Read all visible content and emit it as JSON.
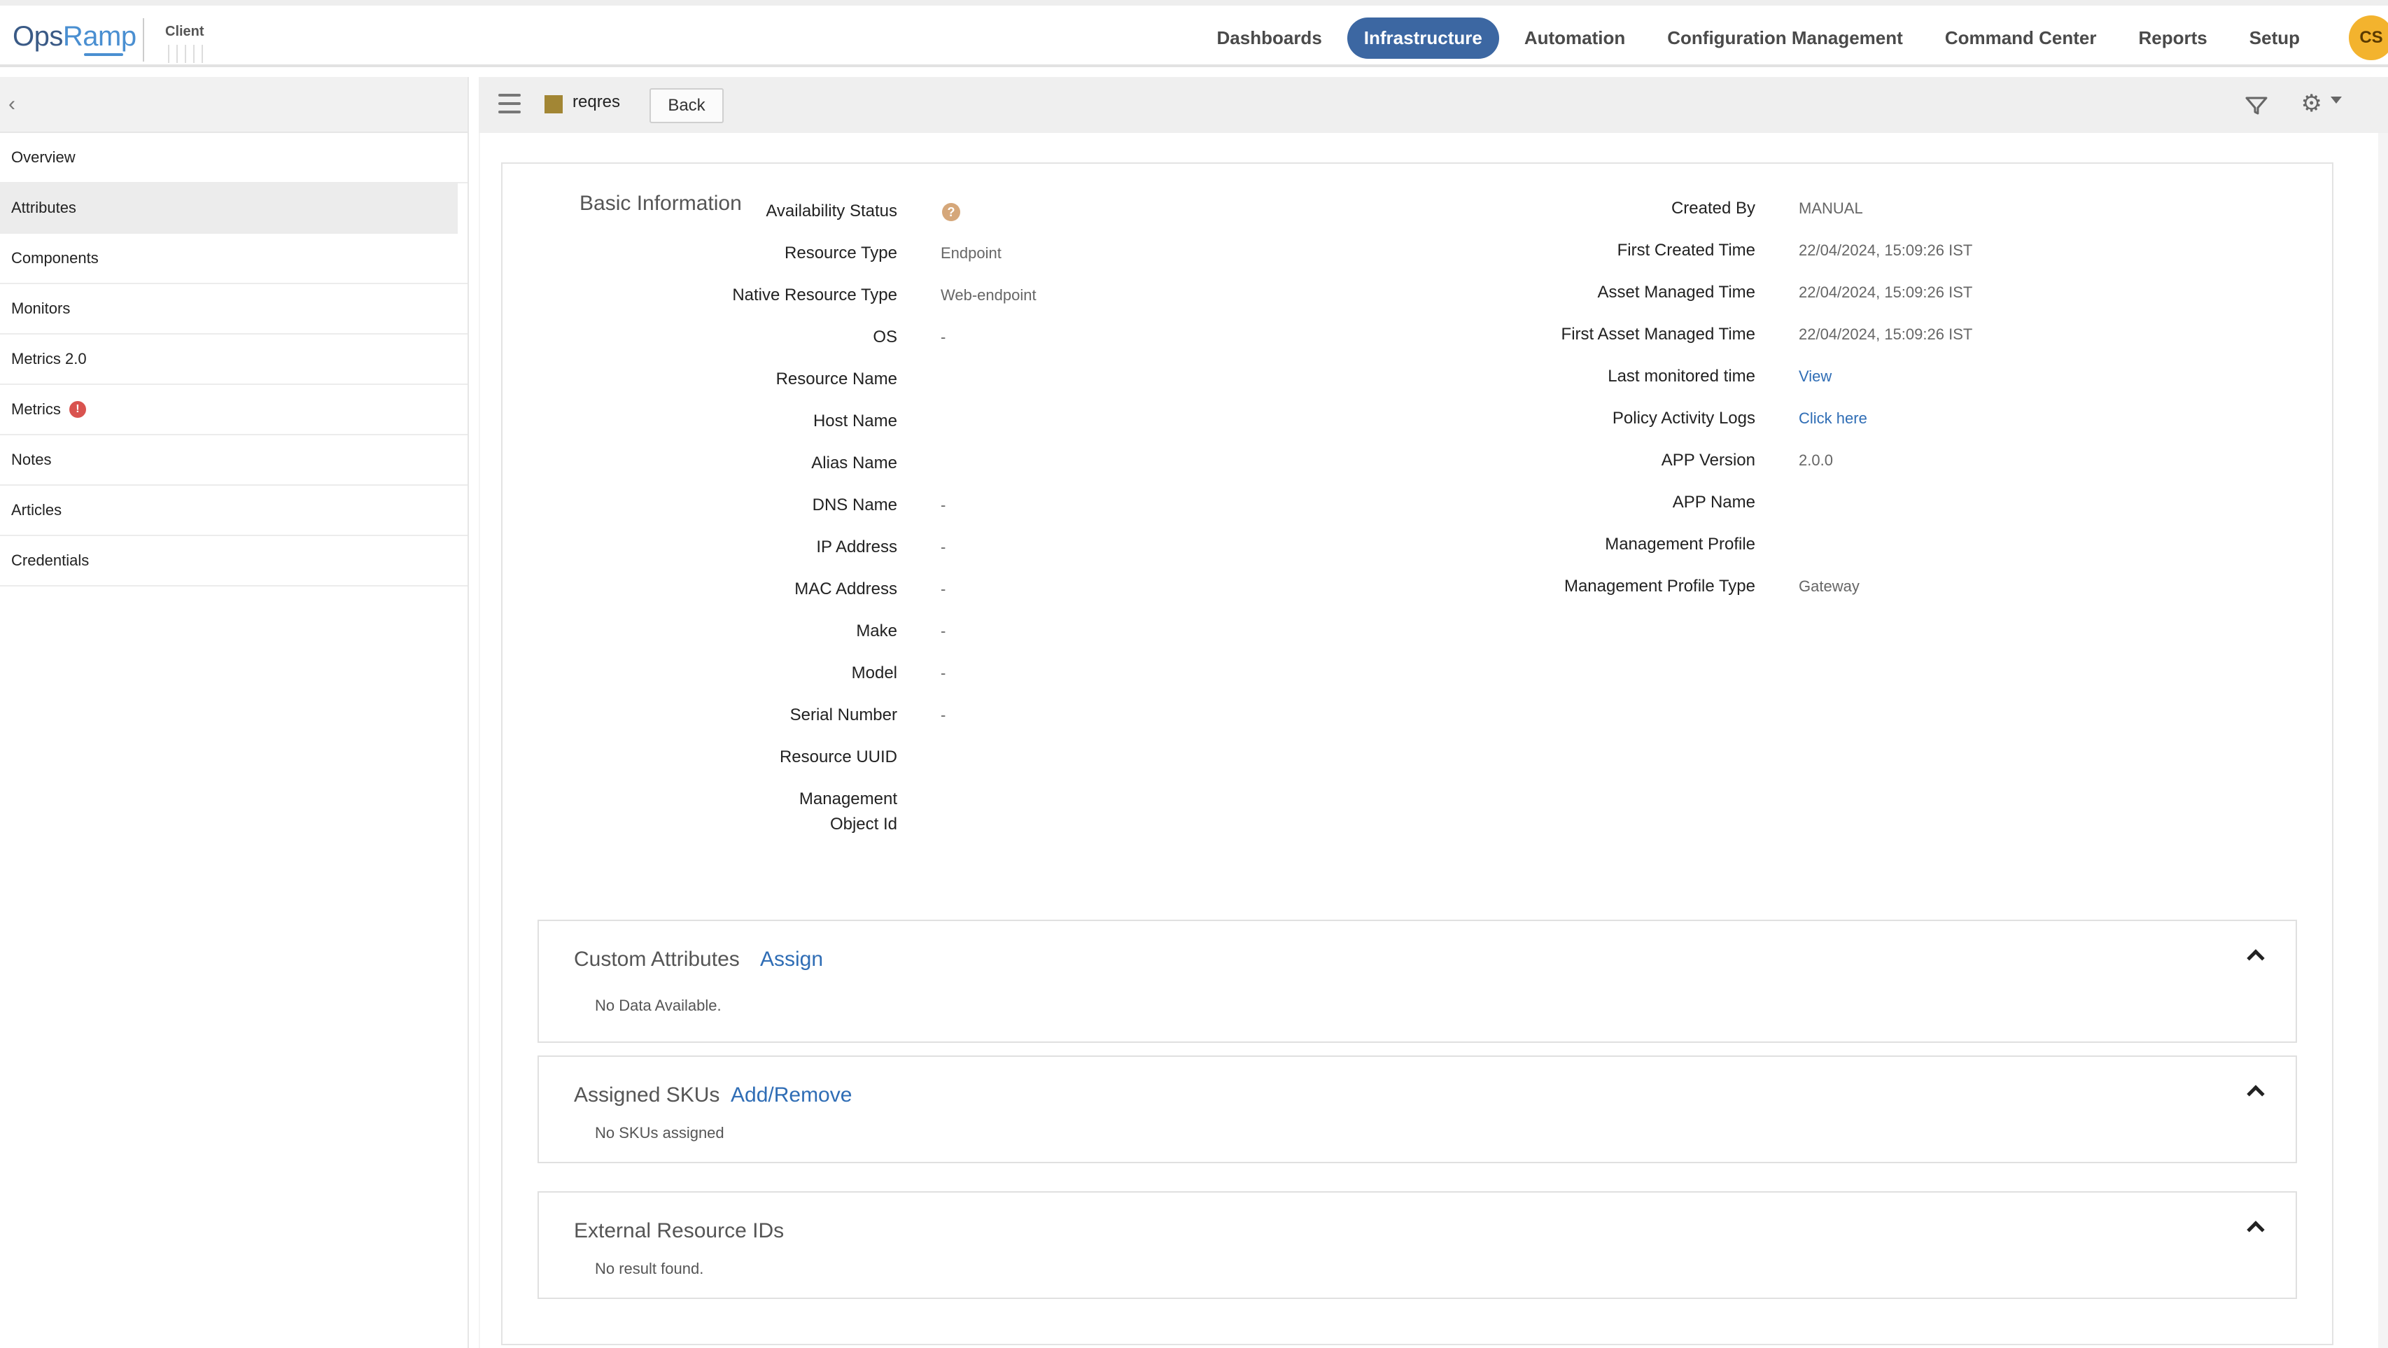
{
  "brand": {
    "logo_ops": "Ops",
    "logo_ramp": "Ramp",
    "client_label": "Client"
  },
  "nav": {
    "items": [
      "Dashboards",
      "Infrastructure",
      "Automation",
      "Configuration Management",
      "Command Center",
      "Reports",
      "Setup"
    ],
    "active": "Infrastructure",
    "avatar_initials": "CS"
  },
  "sidebar": {
    "items": [
      {
        "label": "Overview"
      },
      {
        "label": "Attributes",
        "active": true
      },
      {
        "label": "Components"
      },
      {
        "label": "Monitors"
      },
      {
        "label": "Metrics 2.0"
      },
      {
        "label": "Metrics",
        "alert": "!"
      },
      {
        "label": "Notes"
      },
      {
        "label": "Articles"
      },
      {
        "label": "Credentials"
      }
    ]
  },
  "toolbar": {
    "resource_name": "reqres",
    "back_label": "Back"
  },
  "basic_info": {
    "title": "Basic Information",
    "help_glyph": "?",
    "left": [
      {
        "label": "Availability Status",
        "value": ""
      },
      {
        "label": "Resource Type",
        "value": "Endpoint"
      },
      {
        "label": "Native Resource Type",
        "value": "Web-endpoint"
      },
      {
        "label": "OS",
        "value": "-"
      },
      {
        "label": "Resource Name",
        "value": ""
      },
      {
        "label": "Host Name",
        "value": ""
      },
      {
        "label": "Alias Name",
        "value": ""
      },
      {
        "label": "DNS Name",
        "value": "-"
      },
      {
        "label": "IP Address",
        "value": "-"
      },
      {
        "label": "MAC Address",
        "value": "-"
      },
      {
        "label": "Make",
        "value": "-"
      },
      {
        "label": "Model",
        "value": "-"
      },
      {
        "label": "Serial Number",
        "value": "-"
      },
      {
        "label": "Resource UUID",
        "value": ""
      },
      {
        "label": "Management",
        "label2": "Object Id",
        "value": ""
      }
    ],
    "right": [
      {
        "label": "Created By",
        "value": "MANUAL"
      },
      {
        "label": "First Created Time",
        "value": "22/04/2024, 15:09:26 IST"
      },
      {
        "label": "Asset Managed Time",
        "value": "22/04/2024, 15:09:26 IST"
      },
      {
        "label": "First Asset Managed Time",
        "value": "22/04/2024, 15:09:26 IST"
      },
      {
        "label": "Last monitored time",
        "link": "View"
      },
      {
        "label": "Policy Activity Logs",
        "link": "Click here"
      },
      {
        "label": "APP Version",
        "value": "2.0.0"
      },
      {
        "label": "APP Name",
        "value": ""
      },
      {
        "label": "Management Profile",
        "value": ""
      },
      {
        "label": "Management Profile Type",
        "value": "Gateway"
      }
    ]
  },
  "panels": {
    "custom_attributes": {
      "title": "Custom Attributes",
      "link": "Assign",
      "empty": "No Data Available."
    },
    "assigned_skus": {
      "title": "Assigned SKUs",
      "link": "Add/Remove",
      "empty": "No SKUs assigned"
    },
    "external_ids": {
      "title": "External Resource IDs",
      "empty": "No result found."
    }
  }
}
